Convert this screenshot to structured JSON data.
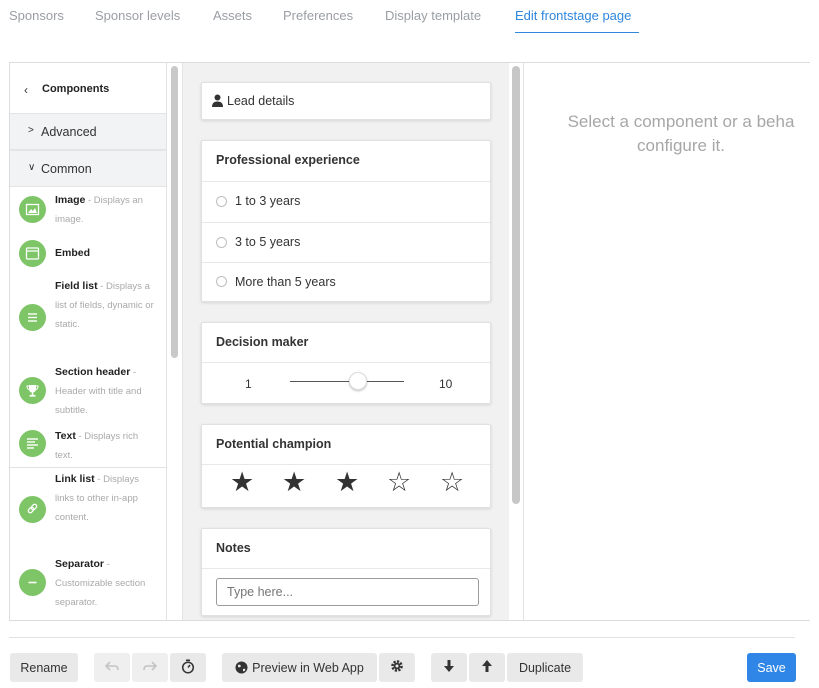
{
  "tabs": [
    "Sponsors",
    "Sponsor levels",
    "Assets",
    "Preferences",
    "Display template",
    "Edit frontstage page"
  ],
  "active_tab_index": 5,
  "colors": {
    "accent": "#2f86dd",
    "component_icon": "#7dc566",
    "save_button": "#2f86e6"
  },
  "sidebar": {
    "back_label": "Components",
    "sections": {
      "advanced": "Advanced",
      "common": "Common"
    },
    "components": [
      {
        "name": "Image",
        "desc": "- Displays an image.",
        "icon": "image-icon"
      },
      {
        "name": "Embed",
        "desc": "",
        "icon": "window-icon"
      },
      {
        "name": "Field list",
        "desc": "- Displays a list of fields, dynamic or static.",
        "icon": "list-icon"
      },
      {
        "name": "Section header",
        "desc": "- Header with title and subtitle.",
        "icon": "trophy-icon"
      },
      {
        "name": "Text",
        "desc": "- Displays rich text.",
        "icon": "text-lines-icon"
      },
      {
        "name": "Link list",
        "desc": "- Displays links to other in-app content.",
        "icon": "link-icon"
      },
      {
        "name": "Separator",
        "desc": "- Customizable section separator.",
        "icon": "minus-icon"
      }
    ]
  },
  "canvas": {
    "lead_details": "Lead details",
    "professional_experience": {
      "title": "Professional experience",
      "options": [
        "1 to 3 years",
        "3 to 5 years",
        "More than 5 years"
      ]
    },
    "decision_maker": {
      "title": "Decision maker",
      "min": "1",
      "max": "10",
      "value_fraction": 0.6
    },
    "potential_champion": {
      "title": "Potential champion",
      "rating": 3,
      "max": 5
    },
    "notes": {
      "title": "Notes",
      "placeholder": "Type here..."
    }
  },
  "right_panel": {
    "message_line1": "Select a component or a beha",
    "message_line2": "configure it."
  },
  "footer": {
    "rename": "Rename",
    "undo_icon": "undo-icon",
    "redo_icon": "redo-icon",
    "history_icon": "stopwatch-icon",
    "preview": "Preview in Web App",
    "preview_icon": "globe-icon",
    "settings_icon": "gear-icon",
    "down_icon": "arrow-down-icon",
    "up_icon": "arrow-up-icon",
    "duplicate": "Duplicate",
    "save": "Save"
  }
}
